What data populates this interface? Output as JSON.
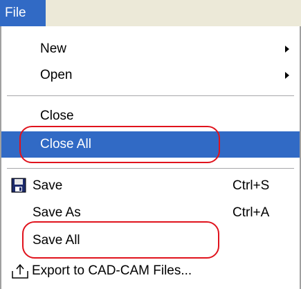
{
  "menubar": {
    "file_label": "File"
  },
  "menu": {
    "items": [
      {
        "label": "New",
        "submenu": true
      },
      {
        "label": "Open",
        "submenu": true
      },
      {
        "label": "Close"
      },
      {
        "label": "Close All",
        "highlighted": true
      },
      {
        "label": "Save",
        "shortcut": "Ctrl+S",
        "icon": "floppy-disk-icon"
      },
      {
        "label": "Save As",
        "shortcut": "Ctrl+A"
      },
      {
        "label": "Save All"
      },
      {
        "label": "Export to CAD-CAM Files...",
        "icon": "export-icon"
      }
    ]
  },
  "colors": {
    "highlight": "#316ac5",
    "annotation": "#e0121c",
    "menubar": "#ece9d8"
  }
}
